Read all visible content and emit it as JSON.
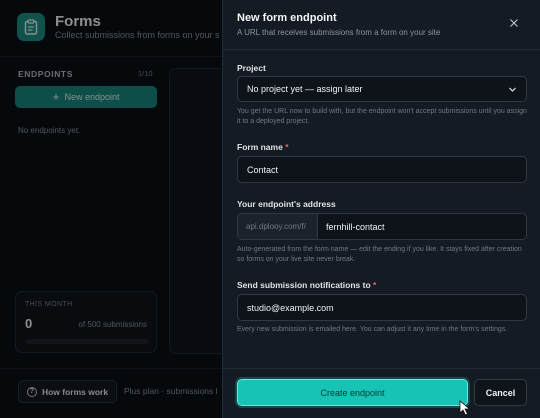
{
  "app": {
    "title": "Forms",
    "subtitle": "Collect submissions from forms on your s",
    "brand_color": "#1a8f83"
  },
  "sidebar": {
    "heading": "ENDPOINTS",
    "count": "1/10",
    "new_button": "New endpoint",
    "empty_text": "No endpoints yet."
  },
  "usage": {
    "label": "THIS MONTH",
    "value": "0",
    "of_text": "of 500 submissions",
    "progress_fraction": 0
  },
  "footer": {
    "how_button": "How forms work",
    "plan_text": "Plus plan · submissions l"
  },
  "drawer": {
    "title": "New form endpoint",
    "subtitle": "A URL that receives submissions from a form on your site",
    "project": {
      "label": "Project",
      "value": "No project yet — assign later",
      "help": "You get the URL now to build with, but the endpoint won't accept submissions until you assign it to a deployed project."
    },
    "form_name": {
      "label": "Form name",
      "required_mark": "*",
      "value": "Contact"
    },
    "address": {
      "label": "Your endpoint's address",
      "prefix": "api.dplooy.com/f/",
      "value": "fernhill-contact",
      "help": "Auto-generated from the form name — edit the ending if you like. It stays fixed after creation so forms on your live site never break."
    },
    "notify": {
      "label": "Send submission notifications to",
      "required_mark": "*",
      "value": "studio@example.com",
      "help": "Every new submission is emailed here. You can adjust it any time in the form's settings."
    },
    "create_button": "Create endpoint",
    "cancel_button": "Cancel",
    "accent_color": "#17c3b4"
  }
}
